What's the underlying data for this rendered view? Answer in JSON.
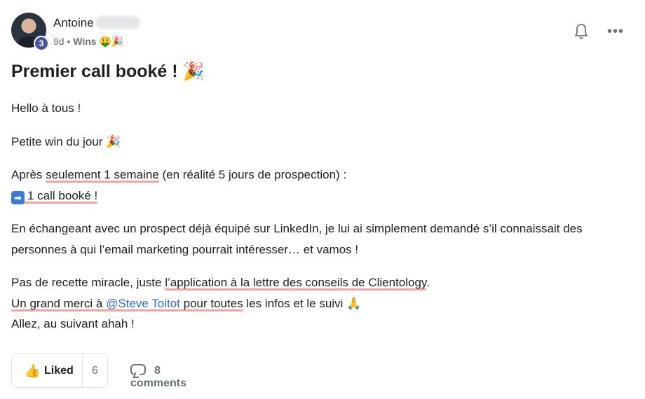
{
  "post": {
    "author": "Antoine",
    "author_level": "3",
    "age": "9d",
    "separator": "•",
    "category": "Wins",
    "category_emojis": "🤑🎉",
    "title": "Premier call booké !",
    "title_emoji": "🎉"
  },
  "body": {
    "p1": "Hello à tous !",
    "p2_text": "Petite win du jour",
    "p2_emoji": "🎉",
    "p3_line1_pre": "Après ",
    "p3_line1_hl": "seulement 1 semaine",
    "p3_line1_post": " (en réalité 5 jours de prospection) :",
    "p3_line2_arrow": "➡",
    "p3_line2_hl": "1 call booké !",
    "p4": "En échangeant avec un prospect déjà équipé sur LinkedIn, je lui ai simplement demandé s’il connaissait des personnes à qui l’email marketing pourrait intéresser… et vamos !",
    "p5_line1_pre": "Pas de recette miracle, juste ",
    "p5_line1_hl": "l’application à la lettre des conseils de Clientology",
    "p5_line1_post": ".",
    "p5_line2_hl_pre": "Un grand merci à ",
    "p5_line2_mention": "@Steve Toitot",
    "p5_line2_hl_post": " pour toutes",
    "p5_line2_post": " les infos et le suivi",
    "p5_line2_emoji": "🙏",
    "p5_line3": "Allez, au suivant ahah !"
  },
  "actions": {
    "like_label": "Liked",
    "like_count": "6",
    "comments_label": "8 comments"
  },
  "icons": {
    "bell": "bell-icon",
    "more": "more-options-icon",
    "thumb": "thumbs-up-icon",
    "comment": "comment-bubble-icon"
  },
  "colors": {
    "highlight_underline": "#f4a3a0",
    "mention": "#2f6ac9",
    "level_badge": "#4a55a2"
  }
}
